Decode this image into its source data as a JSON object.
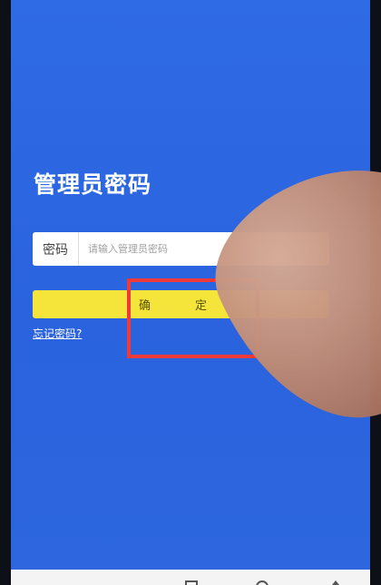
{
  "page": {
    "title": "管理员密码"
  },
  "password_field": {
    "label": "密码",
    "placeholder": "请输入管理员密码",
    "value": ""
  },
  "actions": {
    "confirm_label": "确　定",
    "forgot_label": "忘记密码?"
  },
  "colors": {
    "background": "#2f6be5",
    "confirm_button": "#f5e43a",
    "highlight_box": "#f03a3a"
  },
  "icons": [
    "recents-icon",
    "home-icon",
    "back-icon"
  ]
}
